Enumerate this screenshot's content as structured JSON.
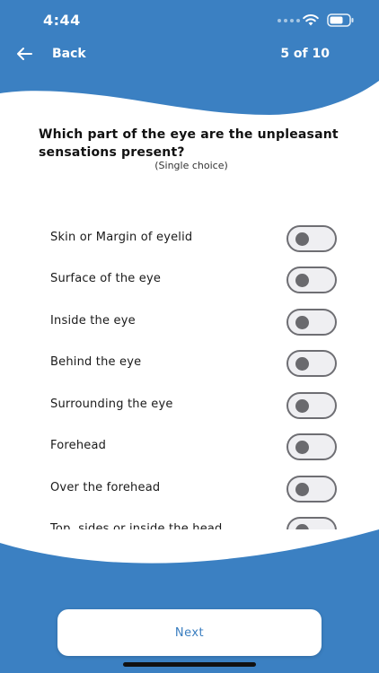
{
  "status_bar": {
    "time": "4:44"
  },
  "header": {
    "back_label": "Back",
    "progress": "5 of 10"
  },
  "question": {
    "text": "Which part of the eye are the unpleasant sensations present?",
    "hint": "(Single choice)"
  },
  "options": [
    {
      "label": "Skin or Margin of eyelid",
      "selected": false
    },
    {
      "label": "Surface of the eye",
      "selected": false
    },
    {
      "label": "Inside the eye",
      "selected": false
    },
    {
      "label": "Behind the eye",
      "selected": false
    },
    {
      "label": "Surrounding the eye",
      "selected": false
    },
    {
      "label": "Forehead",
      "selected": false
    },
    {
      "label": "Over the forehead",
      "selected": false
    },
    {
      "label": "Top, sides or inside the head",
      "selected": false
    }
  ],
  "footer": {
    "next_label": "Next"
  },
  "colors": {
    "accent": "#3a7ec0",
    "background": "#ffffff",
    "toggle_border": "#6e6e73"
  },
  "icons": {
    "back": "arrow-left-icon",
    "wifi": "wifi-icon",
    "battery": "battery-icon",
    "signal": "signal-icon"
  }
}
